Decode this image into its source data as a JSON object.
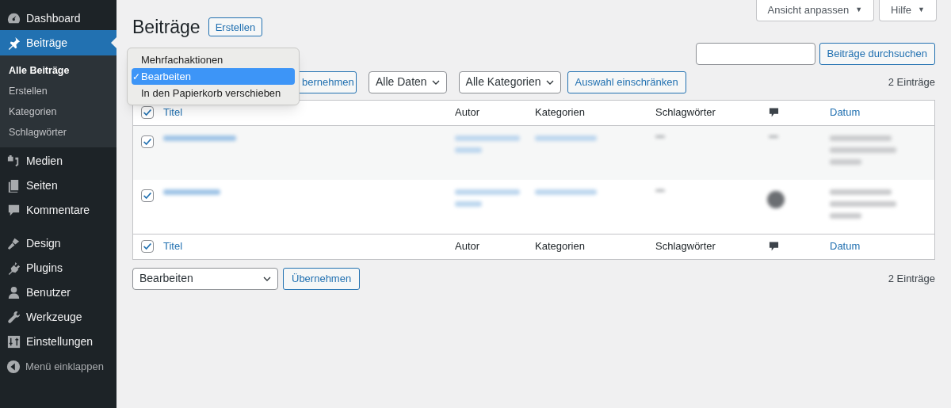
{
  "sidebar": {
    "items": [
      {
        "label": "Dashboard",
        "selected": false
      },
      {
        "label": "Beiträge",
        "selected": true,
        "children": [
          {
            "label": "Alle Beiträge",
            "selected": true
          },
          {
            "label": "Erstellen",
            "selected": false
          },
          {
            "label": "Kategorien",
            "selected": false
          },
          {
            "label": "Schlagwörter",
            "selected": false
          }
        ]
      },
      {
        "label": "Medien",
        "selected": false
      },
      {
        "label": "Seiten",
        "selected": false
      },
      {
        "label": "Kommentare",
        "selected": false
      },
      {
        "label": "Design",
        "selected": false
      },
      {
        "label": "Plugins",
        "selected": false
      },
      {
        "label": "Benutzer",
        "selected": false
      },
      {
        "label": "Werkzeuge",
        "selected": false
      },
      {
        "label": "Einstellungen",
        "selected": false
      }
    ],
    "collapse": "Menü einklappen"
  },
  "top_tabs": [
    "Ansicht anpassen",
    "Hilfe"
  ],
  "caret": "▼",
  "title": "Beiträge",
  "create_button": "Erstellen",
  "search": {
    "button": "Beiträge durchsuchen"
  },
  "bulk_menu": [
    {
      "label": "Mehrfachaktionen",
      "selected": false
    },
    {
      "label": "Bearbeiten",
      "selected": true
    },
    {
      "label": "In den Papierkorb verschieben",
      "selected": false
    }
  ],
  "checkmark": "✓",
  "apply_top": "bernehmen",
  "filters": [
    "Alle Daten",
    "Alle Kategorien"
  ],
  "filter_button": "Auswahl einschränken",
  "count_top": "2 Einträge",
  "table": {
    "columns": [
      "Titel",
      "Autor",
      "Kategorien",
      "Schlagwörter",
      "Datum"
    ],
    "header_checked": true,
    "rows": [
      {
        "checked": true
      },
      {
        "checked": true
      }
    ],
    "footer_columns": [
      "Titel",
      "Autor",
      "Kategorien",
      "Schlagwörter",
      "Datum"
    ],
    "footer_checked": true
  },
  "bulk_bottom": {
    "value": "Bearbeiten",
    "button": "Übernehmen"
  },
  "count_bottom": "2 Einträge"
}
